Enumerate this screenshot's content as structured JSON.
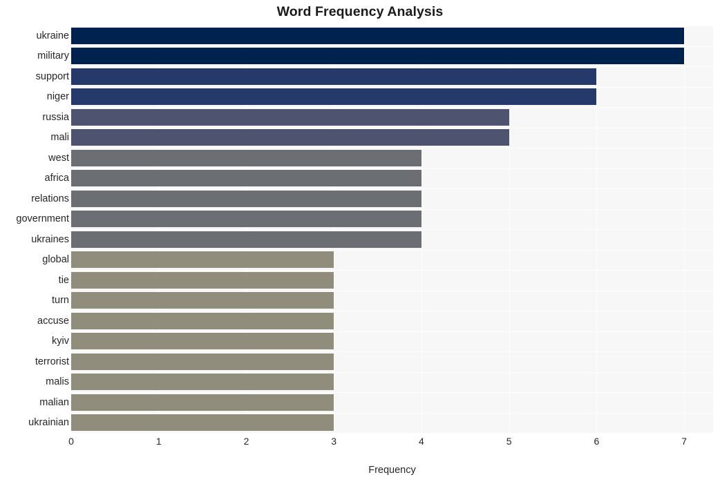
{
  "chart_data": {
    "type": "bar",
    "orientation": "horizontal",
    "title": "Word Frequency Analysis",
    "xlabel": "Frequency",
    "ylabel": "",
    "xlim": [
      0,
      7.33
    ],
    "xticks": [
      0,
      1,
      2,
      3,
      4,
      5,
      6,
      7
    ],
    "xtick_labels": [
      "0",
      "1",
      "2",
      "3",
      "4",
      "5",
      "6",
      "7"
    ],
    "grid": true,
    "legend": "none",
    "categories": [
      "ukraine",
      "military",
      "support",
      "niger",
      "russia",
      "mali",
      "west",
      "africa",
      "relations",
      "government",
      "ukraines",
      "global",
      "tie",
      "turn",
      "accuse",
      "kyiv",
      "terrorist",
      "malis",
      "malian",
      "ukrainian"
    ],
    "values": [
      7,
      7,
      6,
      6,
      5,
      5,
      4,
      4,
      4,
      4,
      4,
      3,
      3,
      3,
      3,
      3,
      3,
      3,
      3,
      3
    ],
    "bar_colors": [
      "#00224e",
      "#00224e",
      "#26396b",
      "#26396b",
      "#4e5470",
      "#4e5470",
      "#6b6e72",
      "#6b6e72",
      "#6b6e72",
      "#6b6e72",
      "#6b6e72",
      "#918d7c",
      "#918d7c",
      "#918d7c",
      "#918d7c",
      "#918d7c",
      "#918d7c",
      "#918d7c",
      "#918d7c",
      "#918d7c"
    ],
    "plot_background": "#f7f7f7",
    "gridline_color": "#ffffff",
    "figure_background": "#ffffff"
  }
}
